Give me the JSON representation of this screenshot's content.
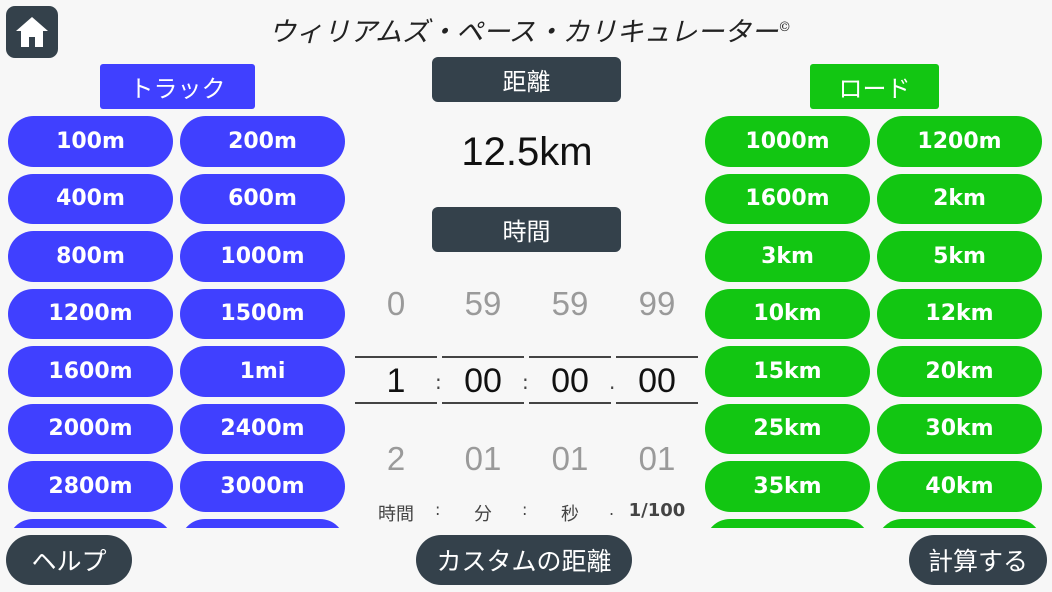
{
  "title": "ウィリアムズ・ペース・カリキュレーター",
  "title_mark": "©",
  "icons": {
    "home": "home-icon"
  },
  "colors": {
    "track": "#4040ff",
    "road": "#12c612",
    "dark": "#34414b"
  },
  "track": {
    "label": "トラック",
    "items": [
      "100m",
      "200m",
      "400m",
      "600m",
      "800m",
      "1000m",
      "1200m",
      "1500m",
      "1600m",
      "1mi",
      "2000m",
      "2400m",
      "2800m",
      "3000m",
      "",
      ""
    ]
  },
  "road": {
    "label": "ロード",
    "items": [
      "1000m",
      "1200m",
      "1600m",
      "2km",
      "3km",
      "5km",
      "10km",
      "12km",
      "15km",
      "20km",
      "25km",
      "30km",
      "35km",
      "40km",
      "",
      ""
    ]
  },
  "distance": {
    "label": "距離",
    "value": "12.5km"
  },
  "time": {
    "label": "時間",
    "columns": [
      {
        "prev": "0",
        "current": "1",
        "next": "2",
        "unit": "時間"
      },
      {
        "prev": "59",
        "current": "00",
        "next": "01",
        "unit": "分"
      },
      {
        "prev": "59",
        "current": "00",
        "next": "01",
        "unit": "秒"
      },
      {
        "prev": "99",
        "current": "00",
        "next": "01",
        "unit": "1/100"
      }
    ],
    "separators": [
      ":",
      ":",
      "."
    ]
  },
  "buttons": {
    "help": "ヘルプ",
    "custom_distance": "カスタムの距離",
    "calculate": "計算する"
  }
}
